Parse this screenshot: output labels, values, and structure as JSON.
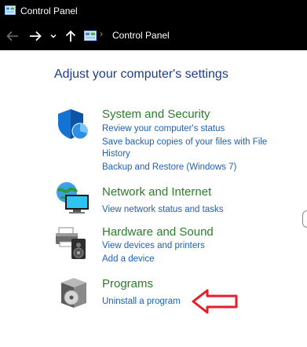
{
  "window": {
    "title": "Control Panel"
  },
  "address_bar": {
    "breadcrumb": "Control Panel",
    "separator": "›"
  },
  "main": {
    "heading": "Adjust your computer's settings",
    "categories": [
      {
        "title": "System and Security",
        "icon": "shield-icon",
        "links": [
          "Review your computer's status",
          "Save backup copies of your files with File",
          "History",
          "Backup and Restore (Windows 7)"
        ]
      },
      {
        "title": "Network and Internet",
        "icon": "network-globe-icon",
        "links": [
          "View network status and tasks"
        ]
      },
      {
        "title": "Hardware and Sound",
        "icon": "printer-speaker-icon",
        "links": [
          "View devices and printers",
          "Add a device"
        ]
      },
      {
        "title": "Programs",
        "icon": "programs-box-icon",
        "links": [
          "Uninstall a program"
        ]
      }
    ]
  },
  "colors": {
    "heading": "#1e3c8c",
    "category_title": "#2b7d2b",
    "link": "#1f5fb9",
    "annotation_arrow": "#e3202a",
    "titlebar_bg": "#000000"
  }
}
